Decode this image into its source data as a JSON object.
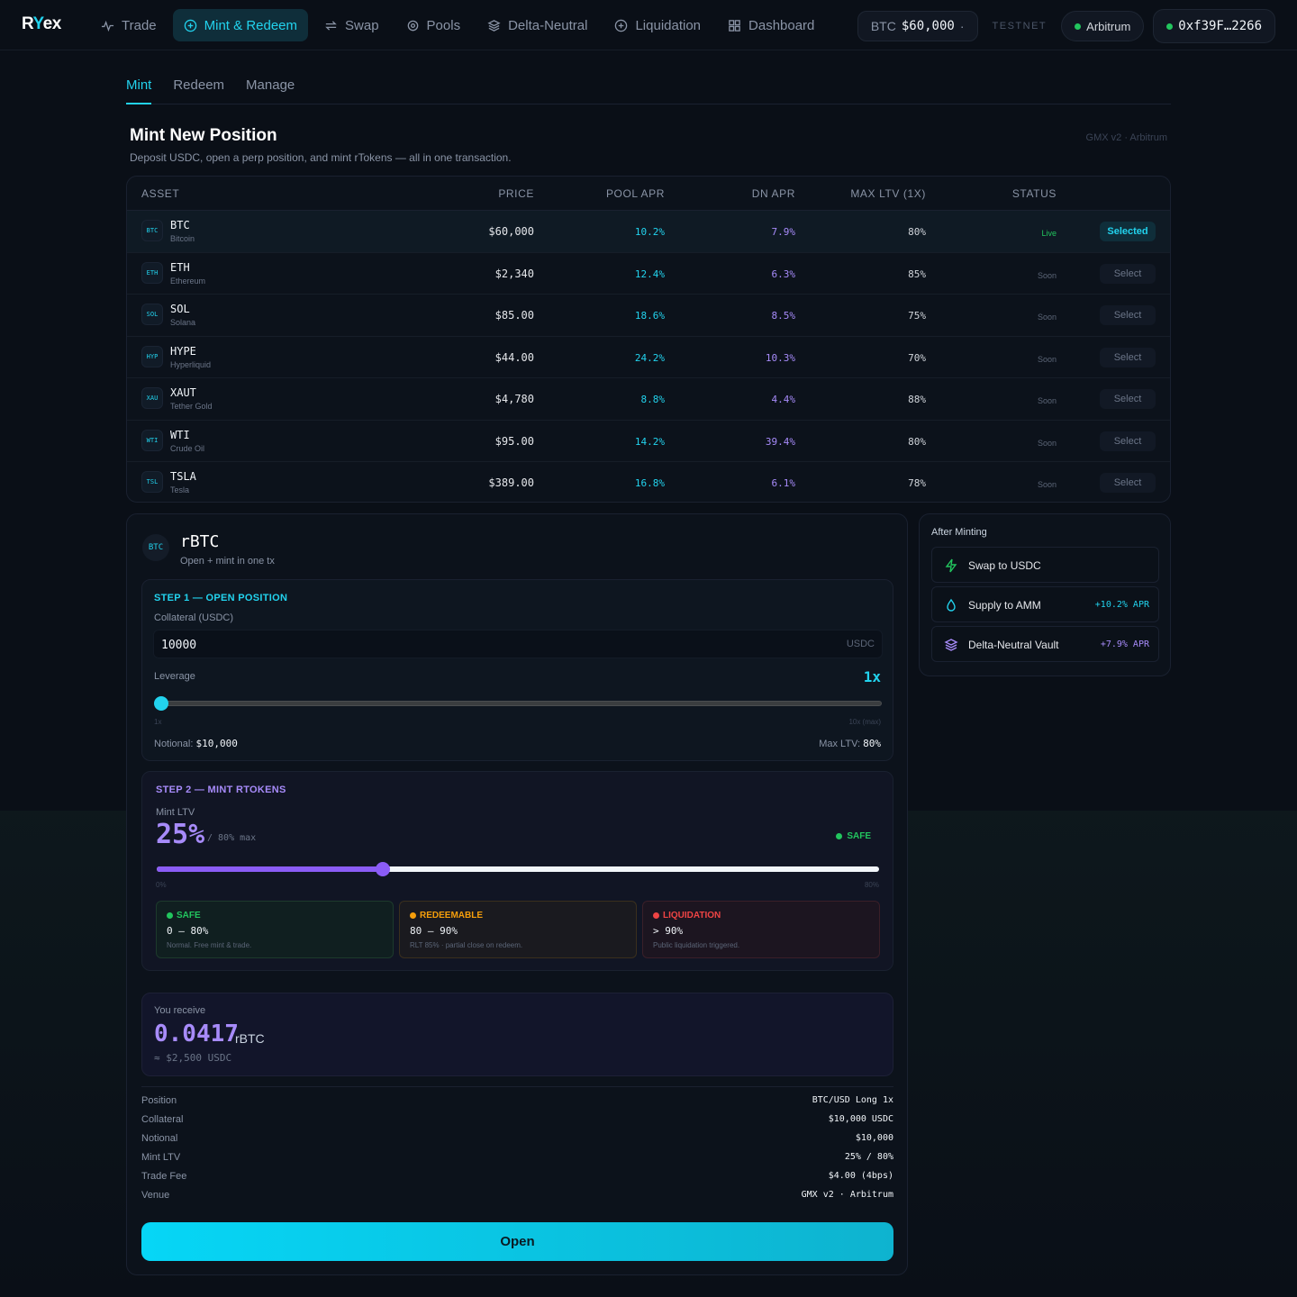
{
  "brand": {
    "logo_r": "R",
    "logo_y": "Y",
    "logo_rest": "ex"
  },
  "nav": {
    "items": [
      {
        "label": "Trade",
        "icon": "activity-icon"
      },
      {
        "label": "Mint & Redeem",
        "icon": "plus-circle-icon",
        "active": true
      },
      {
        "label": "Swap",
        "icon": "repeat-icon"
      },
      {
        "label": "Pools",
        "icon": "target-icon"
      },
      {
        "label": "Delta-Neutral",
        "icon": "layers-icon"
      },
      {
        "label": "Liquidation",
        "icon": "plus-circle-icon"
      },
      {
        "label": "Dashboard",
        "icon": "grid-icon"
      }
    ],
    "price_label": "BTC",
    "price_value": "$60,000",
    "price_sep": "·",
    "testnet": "TESTNET",
    "network": "Arbitrum",
    "wallet": "0xf39F…2266"
  },
  "tabs": [
    "Mint",
    "Redeem",
    "Manage"
  ],
  "header": {
    "title": "Mint New Position",
    "subtitle": "Deposit USDC, open a perp position, and mint rTokens — all in one transaction.",
    "venue": "GMX v2 · Arbitrum"
  },
  "table": {
    "columns": [
      "ASSET",
      "PRICE",
      "POOL APR",
      "DN APR",
      "MAX LTV (1X)",
      "STATUS"
    ],
    "rows": [
      {
        "ico": "BTC",
        "sym": "BTC",
        "name": "Bitcoin",
        "price": "$60,000",
        "pool": "10.2%",
        "dn": "7.9%",
        "ltv": "80%",
        "status": "Live",
        "btn": "Selected"
      },
      {
        "ico": "ETH",
        "sym": "ETH",
        "name": "Ethereum",
        "price": "$2,340",
        "pool": "12.4%",
        "dn": "6.3%",
        "ltv": "85%",
        "status": "Soon",
        "btn": "Select"
      },
      {
        "ico": "SOL",
        "sym": "SOL",
        "name": "Solana",
        "price": "$85.00",
        "pool": "18.6%",
        "dn": "8.5%",
        "ltv": "75%",
        "status": "Soon",
        "btn": "Select"
      },
      {
        "ico": "HYP",
        "sym": "HYPE",
        "name": "Hyperliquid",
        "price": "$44.00",
        "pool": "24.2%",
        "dn": "10.3%",
        "ltv": "70%",
        "status": "Soon",
        "btn": "Select"
      },
      {
        "ico": "XAU",
        "sym": "XAUT",
        "name": "Tether Gold",
        "price": "$4,780",
        "pool": "8.8%",
        "dn": "4.4%",
        "ltv": "88%",
        "status": "Soon",
        "btn": "Select"
      },
      {
        "ico": "WTI",
        "sym": "WTI",
        "name": "Crude Oil",
        "price": "$95.00",
        "pool": "14.2%",
        "dn": "39.4%",
        "ltv": "80%",
        "status": "Soon",
        "btn": "Select"
      },
      {
        "ico": "TSL",
        "sym": "TSLA",
        "name": "Tesla",
        "price": "$389.00",
        "pool": "16.8%",
        "dn": "6.1%",
        "ltv": "78%",
        "status": "Soon",
        "btn": "Select"
      }
    ]
  },
  "mint": {
    "ico": "BTC",
    "title": "rBTC",
    "subtitle": "Open + mint in one tx",
    "step1": {
      "heading": "STEP 1 — OPEN POSITION",
      "collateral_label": "Collateral (USDC)",
      "collateral_value": "10000",
      "collateral_unit": "USDC",
      "leverage_label": "Leverage",
      "leverage_value": "1x",
      "leverage_fraction": 0,
      "tick_min": "1x",
      "tick_max": "10x (max)",
      "notional_label": "Notional:",
      "notional_value": "$10,000",
      "maxltv_label": "Max LTV:",
      "maxltv_value": "80%"
    },
    "step2": {
      "heading": "STEP 2 — MINT RTOKENS",
      "ltv_label": "Mint LTV",
      "ltv_value": "25%",
      "ltv_max": "/ 80% max",
      "ltv_fraction": 0.3125,
      "status": "SAFE",
      "tick_min": "0%",
      "tick_max": "80%",
      "zones": [
        {
          "title": "SAFE",
          "range": "0 – 80%",
          "desc": "Normal. Free mint & trade."
        },
        {
          "title": "REDEEMABLE",
          "range": "80 – 90%",
          "desc": "RLT 85% · partial close on redeem."
        },
        {
          "title": "LIQUIDATION",
          "range": "> 90%",
          "desc": "Public liquidation triggered."
        }
      ]
    },
    "receive": {
      "label": "You receive",
      "amount": "0.0417",
      "unit": "rBTC",
      "usd": "≈ $2,500 USDC"
    },
    "summary": [
      {
        "k": "Position",
        "v": "BTC/USD Long 1x"
      },
      {
        "k": "Collateral",
        "v": "$10,000 USDC"
      },
      {
        "k": "Notional",
        "v": "$10,000"
      },
      {
        "k": "Mint LTV",
        "v": "25% / 80%"
      },
      {
        "k": "Trade Fee",
        "v": "$4.00 (4bps)"
      },
      {
        "k": "Venue",
        "v": "GMX v2 · Arbitrum"
      }
    ],
    "open_label": "Open"
  },
  "after": {
    "heading": "After Minting",
    "items": [
      {
        "label": "Swap to USDC",
        "apr": ""
      },
      {
        "label": "Supply to AMM",
        "apr": "+10.2% APR"
      },
      {
        "label": "Delta-Neutral Vault",
        "apr": "+7.9% APR"
      }
    ]
  },
  "colors": {
    "accent": "#22d3ee",
    "violet": "#a78bfa",
    "safe": "#22c55e",
    "warn": "#f59e0b",
    "danger": "#ef4444"
  }
}
